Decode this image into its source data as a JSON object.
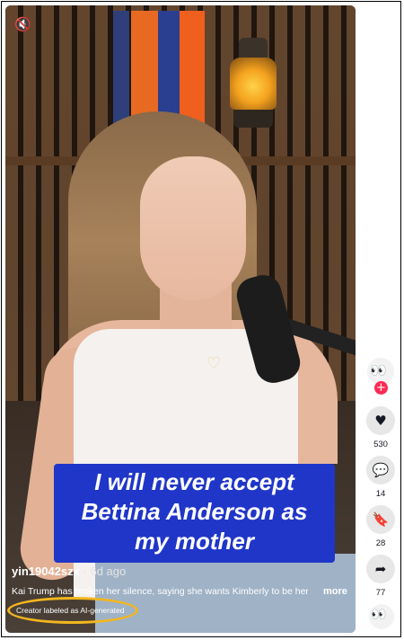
{
  "video": {
    "mute_icon": "volume-muted-icon",
    "caption": "I will never accept\nBettina Anderson as\nmy mother",
    "author": "yin19042szx",
    "age": " · 6d ago",
    "description": "Kai Trump has broken her silence, saying she wants Kimberly to be her",
    "more_label": "more",
    "ai_label": "Creator labeled as AI-generated"
  },
  "actions": {
    "likes": "530",
    "comments": "14",
    "saves": "28",
    "shares": "77"
  },
  "colors": {
    "caption_bg": "#1f36c8",
    "follow_badge": "#fe2c55",
    "highlight_ring": "#f2b61f"
  }
}
